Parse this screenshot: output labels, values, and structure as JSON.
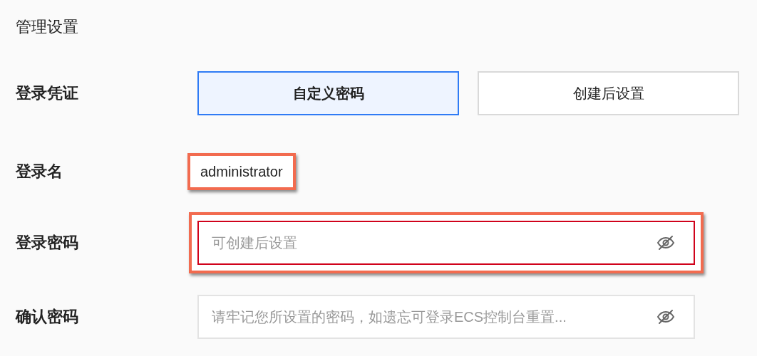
{
  "section_title": "管理设置",
  "login_credential": {
    "label": "登录凭证",
    "options": [
      {
        "label": "自定义密码",
        "selected": true
      },
      {
        "label": "创建后设置",
        "selected": false
      }
    ]
  },
  "login_name": {
    "label": "登录名",
    "value": "administrator",
    "highlighted": true
  },
  "password_fields": [
    {
      "label": "登录密码",
      "placeholder": "可创建后设置",
      "highlighted": true,
      "error": true
    },
    {
      "label": "确认密码",
      "placeholder": "请牢记您所设置的密码，如遗忘可登录ECS控制台重置...",
      "highlighted": false,
      "error": false
    }
  ]
}
